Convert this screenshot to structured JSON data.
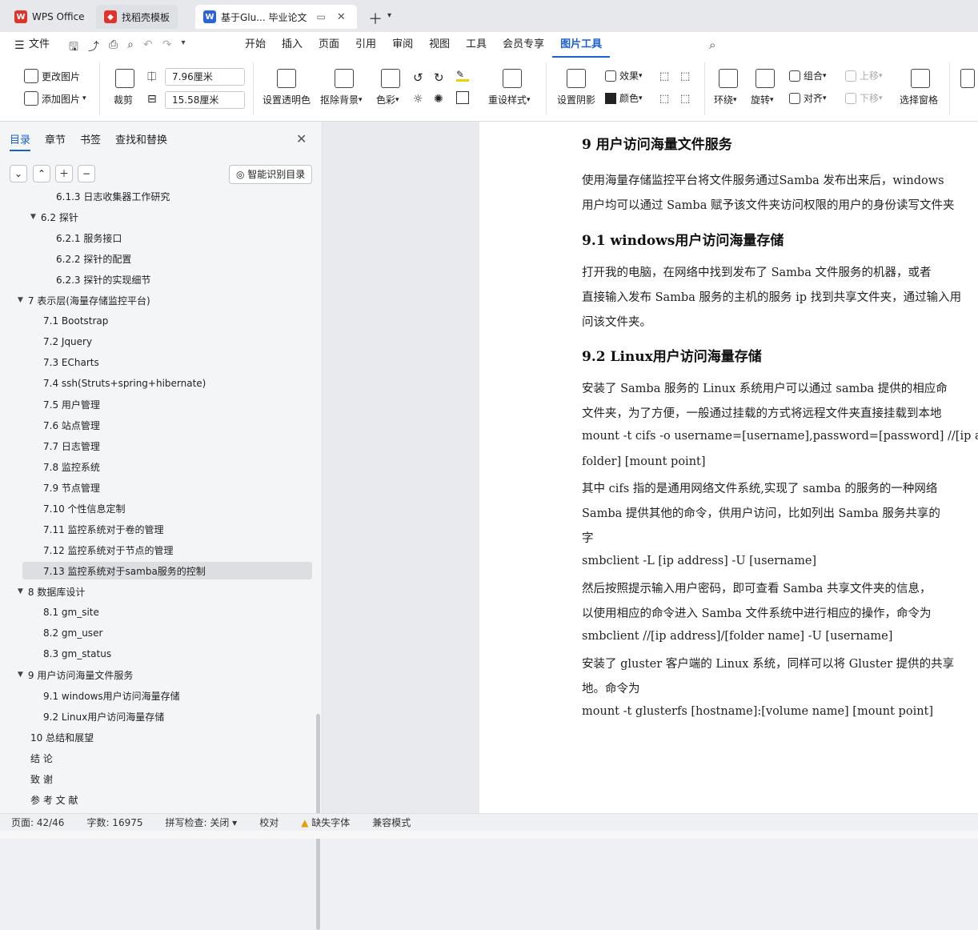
{
  "tabs": [
    {
      "label": "WPS Office",
      "icon": "wps-logo-icon"
    },
    {
      "label": "找稻壳模板",
      "icon": "docer-icon"
    },
    {
      "label": "基于Glu... 毕业论文",
      "icon": "word-doc-icon"
    }
  ],
  "menubar": {
    "file": "文件",
    "items": [
      "开始",
      "插入",
      "页面",
      "引用",
      "审阅",
      "视图",
      "工具",
      "会员专享",
      "图片工具"
    ],
    "active": "图片工具"
  },
  "ribbon": {
    "change_image": "更改图片",
    "add_image": "添加图片",
    "crop": "裁剪",
    "width_value": "7.96厘米",
    "height_value": "15.58厘米",
    "set_transparent": "设置透明色",
    "remove_bg": "抠除背景",
    "color": "色彩",
    "recolor": "重设样式",
    "set_shadow": "设置阴影",
    "effect": "效果",
    "shade": "颜色",
    "wrap": "环绕",
    "rotate": "旋转",
    "group": "组合",
    "align": "对齐",
    "move_up": "上移",
    "move_down": "下移",
    "selection_pane": "选择窗格"
  },
  "sidebar": {
    "tabs": [
      "目录",
      "章节",
      "书签",
      "查找和替换"
    ],
    "smart_toc": "智能识别目录",
    "toc": [
      {
        "text": "6.1.3   日志收集器工作研究",
        "level": 3
      },
      {
        "text": "6.2   探针",
        "level": 2,
        "arrow": true
      },
      {
        "text": "6.2.1   服务接口",
        "level": 3
      },
      {
        "text": "6.2.2   探针的配置",
        "level": 3
      },
      {
        "text": "6.2.3   探针的实现细节",
        "level": 3
      },
      {
        "text": "7   表示层(海量存储监控平台)",
        "level": 1,
        "arrow": true
      },
      {
        "text": "7.1   Bootstrap",
        "level": 2
      },
      {
        "text": "7.2   Jquery",
        "level": 2
      },
      {
        "text": "7.3   ECharts",
        "level": 2
      },
      {
        "text": "7.4   ssh(Struts+spring+hibernate)",
        "level": 2
      },
      {
        "text": "7.5   用户管理",
        "level": 2
      },
      {
        "text": "7.6   站点管理",
        "level": 2
      },
      {
        "text": "7.7   日志管理",
        "level": 2
      },
      {
        "text": "7.8   监控系统",
        "level": 2
      },
      {
        "text": "7.9   节点管理",
        "level": 2
      },
      {
        "text": "7.10   个性信息定制",
        "level": 2
      },
      {
        "text": "7.11   监控系统对于卷的管理",
        "level": 2
      },
      {
        "text": "7.12   监控系统对于节点的管理",
        "level": 2
      },
      {
        "text": "7.13   监控系统对于samba服务的控制",
        "level": 2,
        "selected": true
      },
      {
        "text": "8   数据库设计",
        "level": 1,
        "arrow": true
      },
      {
        "text": "8.1   gm_site",
        "level": 2
      },
      {
        "text": "8.2   gm_user",
        "level": 2
      },
      {
        "text": "8.3   gm_status",
        "level": 2
      },
      {
        "text": "9   用户访问海量文件服务",
        "level": 1,
        "arrow": true
      },
      {
        "text": "9.1   windows用户访问海量存储",
        "level": 2
      },
      {
        "text": "9.2   Linux用户访问海量存储",
        "level": 2
      },
      {
        "text": "10   总结和展望",
        "level": 1
      },
      {
        "text": "结   论",
        "level": 1
      },
      {
        "text": "致   谢",
        "level": 1
      },
      {
        "text": "参 考 文 献",
        "level": 1
      }
    ]
  },
  "document": {
    "h9": "9       用户访问海量文件服务",
    "p1a": "        使用海量存储监控平台将文件服务通过Samba 发布出来后，windows",
    "p1b": "用户均可以通过 Samba 赋予该文件夹访问权限的用户的身份读写文件夹",
    "h91": "9.1     windows用户访问海量存储",
    "p2a": "        打开我的电脑，在网络中找到发布了 Samba 文件服务的机器，或者",
    "p2b": "直接输入发布 Samba 服务的主机的服务 ip 找到共享文件夹，通过输入用",
    "p2c": "问该文件夹。",
    "h92": "9.2     Linux用户访问海量存储",
    "p3a": "        安装了 Samba 服务的 Linux 系统用户可以通过 samba 提供的相应命",
    "p3b": "文件夹，为了方便，一般通过挂载的方式将远程文件夹直接挂载到本地",
    "p4a": "        mount  -t  cifs  -o  username=[username],password=[password]  //[ip  a",
    "p4b": "folder] [mount point]",
    "p5": "        其中 cifs 指的是通用网络文件系统,实现了 samba 的服务的一种网络",
    "p6a": "        Samba 提供其他的命令，供用户访问，比如列出 Samba 服务共享的",
    "p6b": "字",
    "p7": "     smbclient -L [ip address] -U [username]",
    "p8a": "        然后按照提示输入用户密码，即可查看 Samba 共享文件夹的信息，",
    "p8b": "以使用相应的命令进入 Samba 文件系统中进行相应的操作，命令为",
    "p9": "     smbclient //[ip address]/[folder name] -U [username]",
    "p10a": "        安装了 gluster 客户端的 Linux 系统，同样可以将 Gluster 提供的共享",
    "p10b": "地。命令为",
    "p11": "     mount -t glusterfs [hostname]:[volume name] [mount point]"
  },
  "status": {
    "page": "页面: 42/46",
    "words": "字数: 16975",
    "spell": "拼写检查: 关闭",
    "proof": "校对",
    "missing_font": "缺失字体",
    "compat": "兼容模式"
  }
}
